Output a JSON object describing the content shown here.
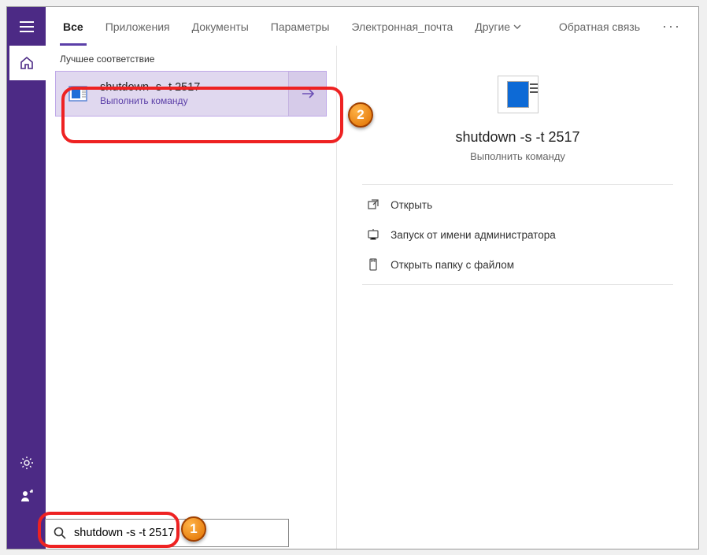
{
  "tabs": {
    "all": "Все",
    "apps": "Приложения",
    "docs": "Документы",
    "params": "Параметры",
    "email": "Электронная_почта",
    "other": "Другие",
    "feedback": "Обратная связь"
  },
  "section": {
    "best_match": "Лучшее соответствие"
  },
  "result": {
    "title": "shutdown -s -t 2517",
    "subtitle": "Выполнить команду"
  },
  "detail": {
    "title": "shutdown -s -t 2517",
    "subtitle": "Выполнить команду"
  },
  "actions": {
    "open": "Открыть",
    "run_admin": "Запуск от имени администратора",
    "open_folder": "Открыть папку с файлом"
  },
  "search": {
    "value": "shutdown -s -t 2517"
  },
  "badges": {
    "one": "1",
    "two": "2"
  }
}
